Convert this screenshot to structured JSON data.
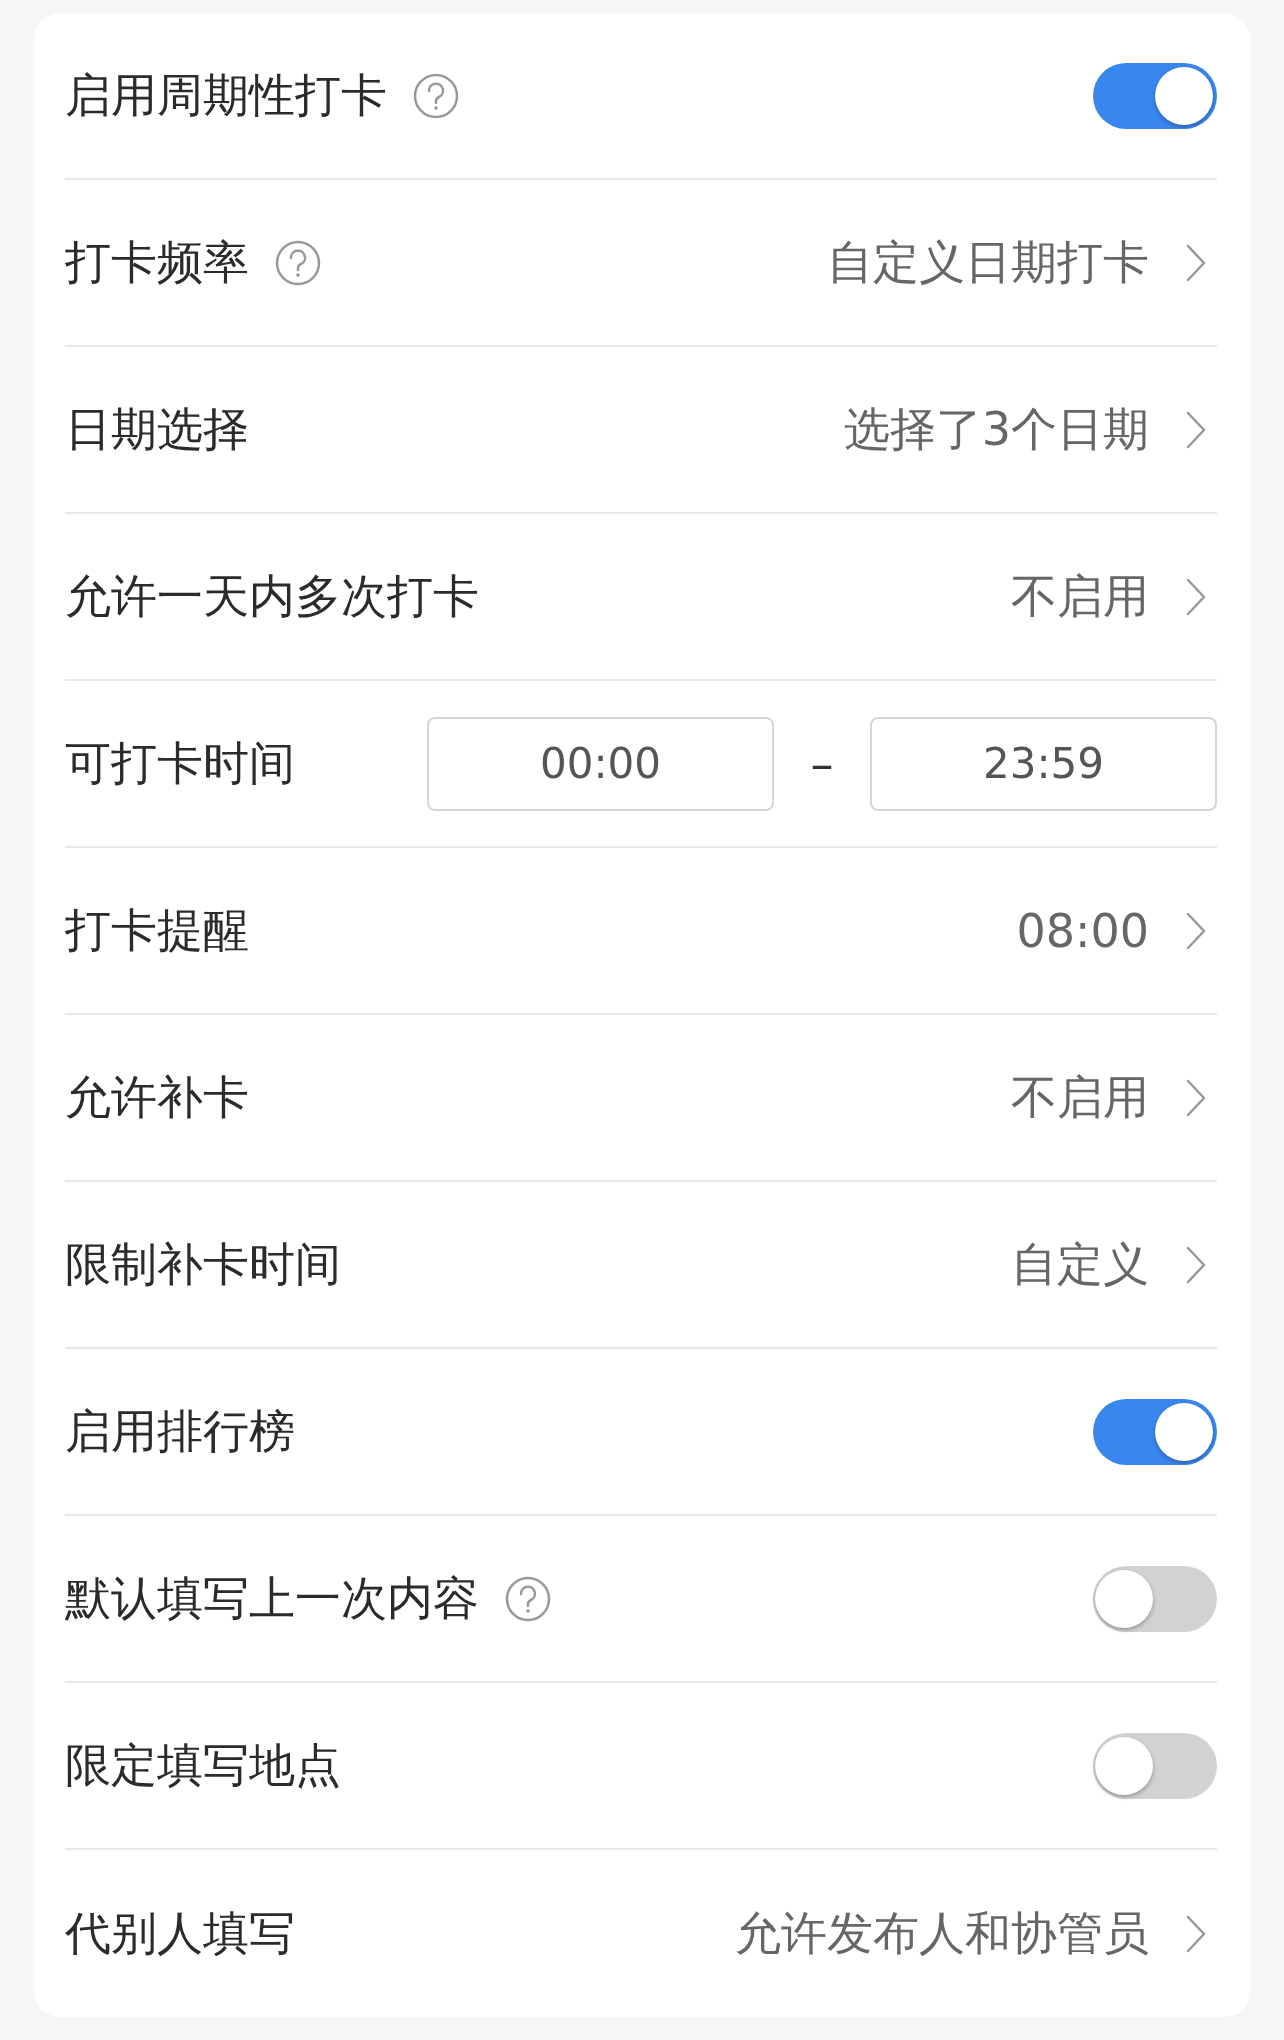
{
  "rows": [
    {
      "kind": "toggle",
      "label": "启用周期性打卡",
      "help": true,
      "on": true
    },
    {
      "kind": "select",
      "label": "打卡频率",
      "help": true,
      "value": "自定义日期打卡"
    },
    {
      "kind": "select",
      "label": "日期选择",
      "help": false,
      "value": "选择了3个日期"
    },
    {
      "kind": "select",
      "label": "允许一天内多次打卡",
      "help": false,
      "value": "不启用"
    },
    {
      "kind": "time_range",
      "label": "可打卡时间",
      "help": false,
      "start": "00:00",
      "separator": "–",
      "end": "23:59"
    },
    {
      "kind": "select",
      "label": "打卡提醒",
      "help": false,
      "value": "08:00"
    },
    {
      "kind": "select",
      "label": "允许补卡",
      "help": false,
      "value": "不启用"
    },
    {
      "kind": "select",
      "label": "限制补卡时间",
      "help": false,
      "value": "自定义"
    },
    {
      "kind": "toggle",
      "label": "启用排行榜",
      "help": false,
      "on": true
    },
    {
      "kind": "toggle",
      "label": "默认填写上一次内容",
      "help": true,
      "on": false
    },
    {
      "kind": "toggle",
      "label": "限定填写地点",
      "help": false,
      "on": false
    },
    {
      "kind": "select",
      "label": "代别人填写",
      "help": false,
      "value": "允许发布人和协管员"
    }
  ]
}
